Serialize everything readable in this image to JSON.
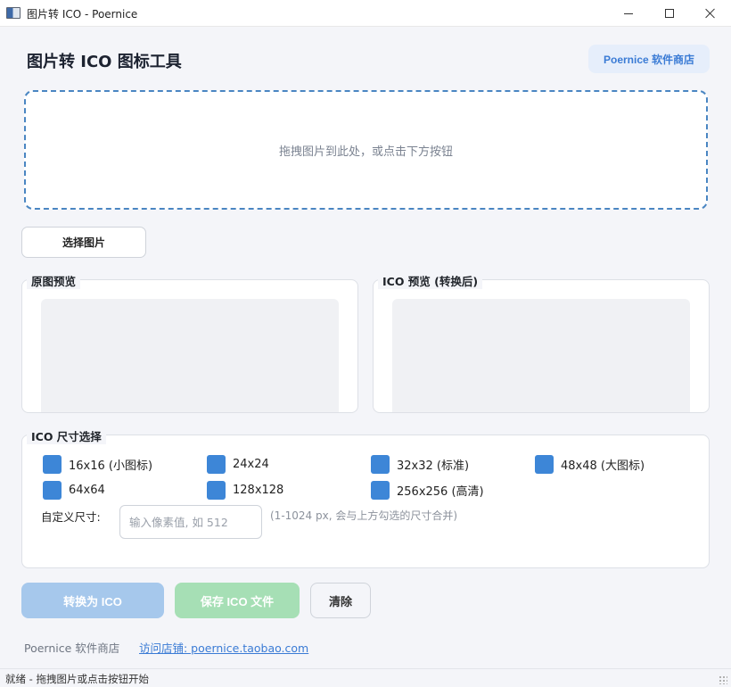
{
  "window": {
    "title": "图片转 ICO - Poernice",
    "minimize_glyph": "—",
    "maximize_glyph": "☐",
    "close_glyph": "✕"
  },
  "header": {
    "title": "图片转 ICO 图标工具",
    "store_button": "Poernice 软件商店"
  },
  "dropzone": {
    "hint": "拖拽图片到此处，或点击下方按钮"
  },
  "select_button": "选择图片",
  "preview": {
    "original_title": "原图预览",
    "ico_title": "ICO 预览 (转换后)"
  },
  "sizes": {
    "title": "ICO 尺寸选择",
    "options": [
      {
        "label": "16x16 (小图标)",
        "checked": true
      },
      {
        "label": "24x24",
        "checked": true
      },
      {
        "label": "32x32 (标准)",
        "checked": true
      },
      {
        "label": "48x48 (大图标)",
        "checked": true
      },
      {
        "label": "64x64",
        "checked": true
      },
      {
        "label": "128x128",
        "checked": true
      },
      {
        "label": "256x256 (高清)",
        "checked": true
      }
    ],
    "custom_label": "自定义尺寸:",
    "custom_placeholder": "输入像素值, 如 512",
    "custom_value": "",
    "custom_hint": "(1-1024 px, 会与上方勾选的尺寸合并)"
  },
  "actions": {
    "convert": "转换为 ICO",
    "save": "保存 ICO 文件",
    "clear": "清除"
  },
  "footer": {
    "store": "Poernice 软件商店",
    "link": "访问店铺: poernice.taobao.com"
  },
  "status": "就绪 - 拖拽图片或点击按钮开始",
  "colors": {
    "accent": "#3d86d7",
    "dropzone_border": "#4a86c2",
    "convert_disabled": "#a6c8ec",
    "save_disabled": "#a6dfb5"
  }
}
